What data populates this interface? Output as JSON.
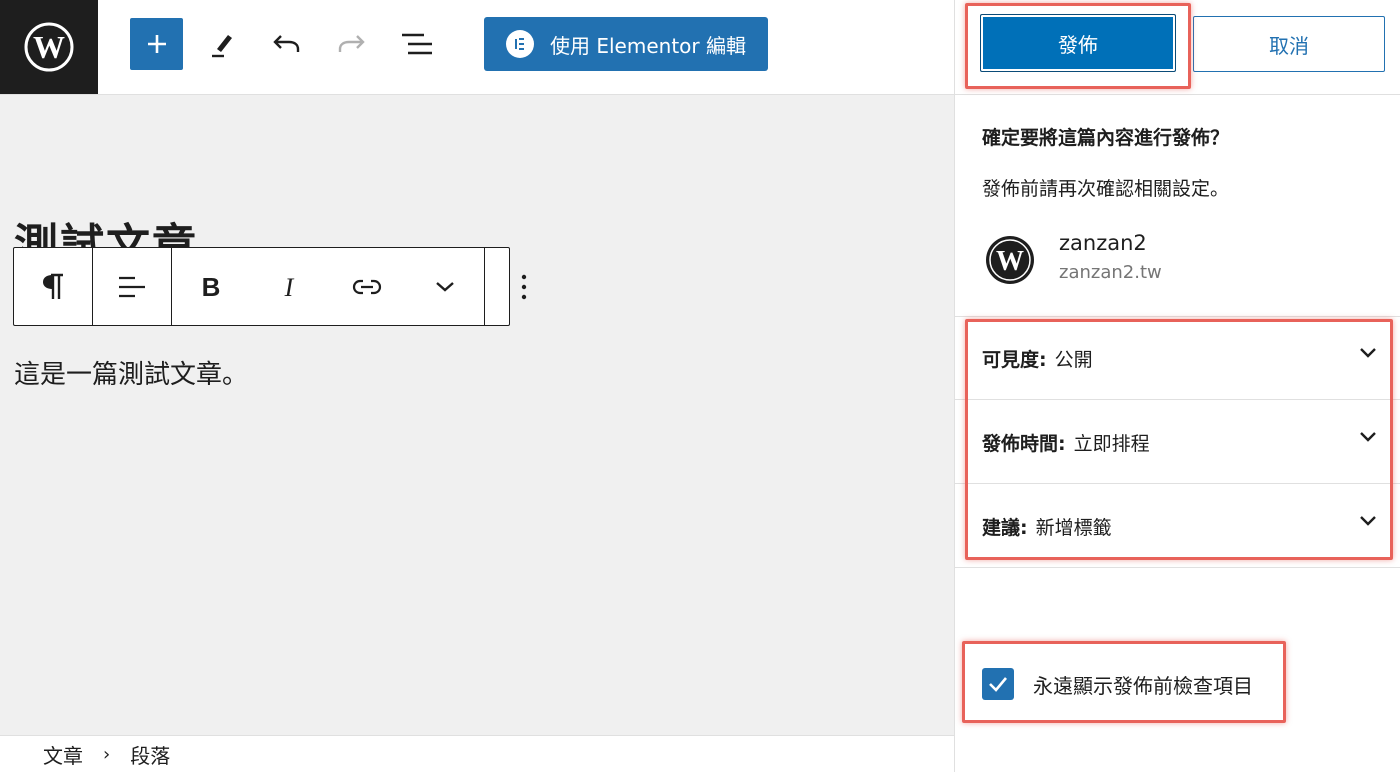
{
  "toolbar": {
    "elementor_label": "使用 Elementor 編輯"
  },
  "editor": {
    "post_title": "測試文章",
    "paragraph": "這是一篇測試文章。"
  },
  "breadcrumb": {
    "items": [
      "文章",
      "段落"
    ],
    "separator": "›"
  },
  "publish_panel": {
    "publish_label": "發佈",
    "cancel_label": "取消",
    "confirm_title": "確定要將這篇內容進行發佈？",
    "confirm_desc": "發佈前請再次確認相關設定。",
    "site_name": "zanzan2",
    "site_url": "zanzan2.tw",
    "rows": [
      {
        "label": "可見度:",
        "value": "公開"
      },
      {
        "label": "發佈時間:",
        "value": "立即排程"
      },
      {
        "label": "建議:",
        "value": "新增標籤"
      }
    ],
    "always_show_label": "永遠顯示發佈前檢查項目",
    "always_show_checked": true
  },
  "colors": {
    "accent": "#2271b1",
    "highlight": "#e8625a",
    "dark": "#1e1e1e"
  },
  "icons": [
    "wordpress-logo-icon",
    "plus-icon",
    "pen-icon",
    "undo-icon",
    "redo-icon",
    "list-view-icon",
    "elementor-icon",
    "paragraph-icon",
    "align-icon",
    "bold-icon",
    "italic-icon",
    "link-icon",
    "chevron-down-icon",
    "more-vertical-icon",
    "checkmark-icon"
  ]
}
